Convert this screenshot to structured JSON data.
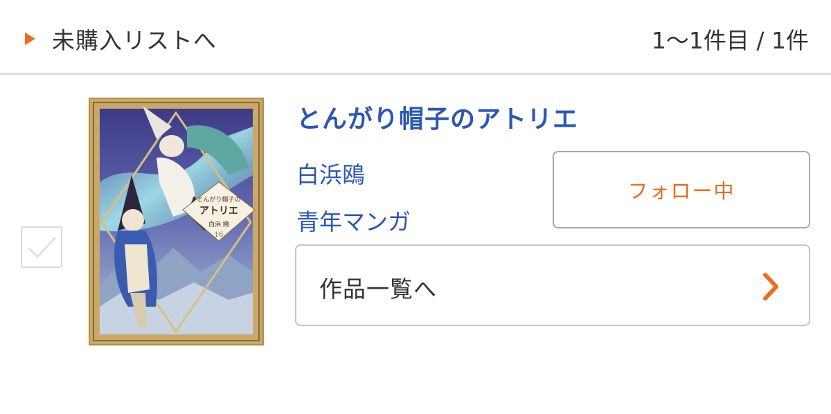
{
  "header": {
    "back_label": "未購入リストへ",
    "count_text": "1〜1件目 / 1件",
    "icon": "play-triangle-icon",
    "accent_color": "#ef6c1e"
  },
  "item": {
    "title": "とんがり帽子のアトリエ",
    "author": "白浜鴎",
    "genre": "青年マンガ",
    "follow_label": "フォロー中",
    "works_label": "作品一覧へ",
    "checked": false,
    "cover": {
      "series_title": "とんがり帽子のアトリエ",
      "volume": "16",
      "author": "白浜 鴎"
    }
  },
  "colors": {
    "link_blue": "#2a56b6",
    "accent_orange": "#e86a1f",
    "border_gray": "#c4c4c4"
  }
}
